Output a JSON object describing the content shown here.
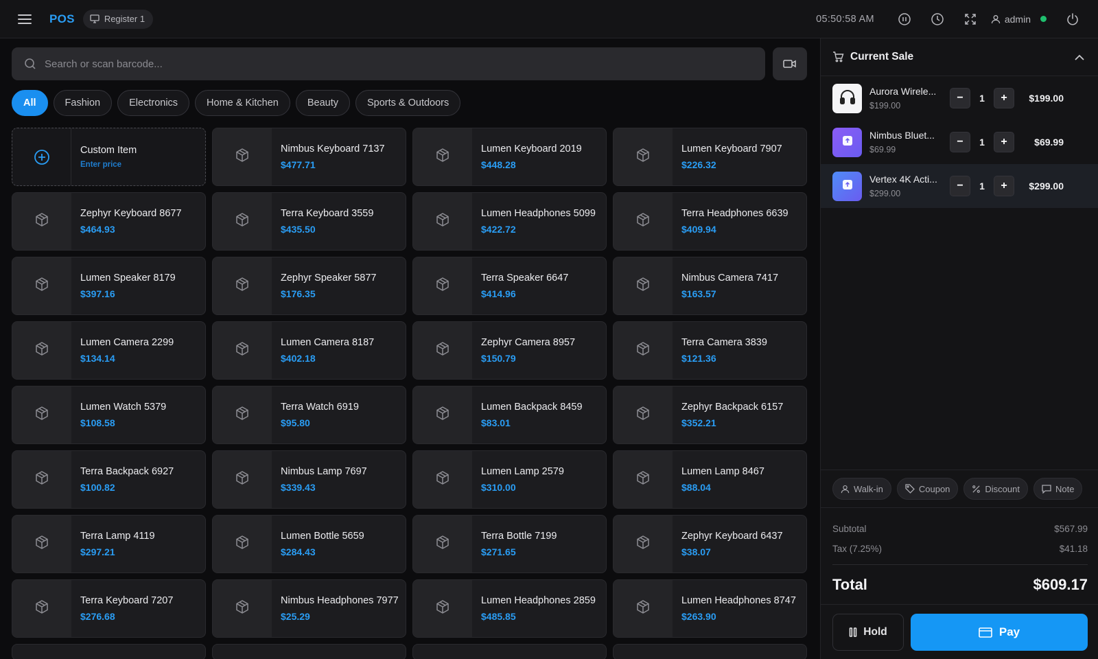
{
  "header": {
    "brand": "POS",
    "register": "Register 1",
    "clock": "05:50:58 AM",
    "user": "admin",
    "online_color": "#1fbf6e"
  },
  "search": {
    "placeholder": "Search or scan barcode..."
  },
  "categories": [
    "All",
    "Fashion",
    "Electronics",
    "Home & Kitchen",
    "Beauty",
    "Sports & Outdoors"
  ],
  "active_category": "All",
  "custom_item": {
    "name": "Custom Item",
    "subtitle": "Enter price"
  },
  "products": [
    {
      "name": "Nimbus Keyboard 7137",
      "price": "$477.71"
    },
    {
      "name": "Lumen Keyboard 2019",
      "price": "$448.28"
    },
    {
      "name": "Lumen Keyboard 7907",
      "price": "$226.32"
    },
    {
      "name": "Zephyr Keyboard 8677",
      "price": "$464.93"
    },
    {
      "name": "Terra Keyboard 3559",
      "price": "$435.50"
    },
    {
      "name": "Lumen Headphones 5099",
      "price": "$422.72"
    },
    {
      "name": "Terra Headphones 6639",
      "price": "$409.94"
    },
    {
      "name": "Lumen Speaker 8179",
      "price": "$397.16"
    },
    {
      "name": "Zephyr Speaker 5877",
      "price": "$176.35"
    },
    {
      "name": "Terra Speaker 6647",
      "price": "$414.96"
    },
    {
      "name": "Nimbus Camera 7417",
      "price": "$163.57"
    },
    {
      "name": "Lumen Camera 2299",
      "price": "$134.14"
    },
    {
      "name": "Lumen Camera 8187",
      "price": "$402.18"
    },
    {
      "name": "Zephyr Camera 8957",
      "price": "$150.79"
    },
    {
      "name": "Terra Camera 3839",
      "price": "$121.36"
    },
    {
      "name": "Lumen Watch 5379",
      "price": "$108.58"
    },
    {
      "name": "Terra Watch 6919",
      "price": "$95.80"
    },
    {
      "name": "Lumen Backpack 8459",
      "price": "$83.01"
    },
    {
      "name": "Zephyr Backpack 6157",
      "price": "$352.21"
    },
    {
      "name": "Terra Backpack 6927",
      "price": "$100.82"
    },
    {
      "name": "Nimbus Lamp 7697",
      "price": "$339.43"
    },
    {
      "name": "Lumen Lamp 2579",
      "price": "$310.00"
    },
    {
      "name": "Lumen Lamp 8467",
      "price": "$88.04"
    },
    {
      "name": "Terra Lamp 4119",
      "price": "$297.21"
    },
    {
      "name": "Lumen Bottle 5659",
      "price": "$284.43"
    },
    {
      "name": "Terra Bottle 7199",
      "price": "$271.65"
    },
    {
      "name": "Zephyr Keyboard 6437",
      "price": "$38.07"
    },
    {
      "name": "Terra Keyboard 7207",
      "price": "$276.68"
    },
    {
      "name": "Nimbus Headphones 7977",
      "price": "$25.29"
    },
    {
      "name": "Lumen Headphones 2859",
      "price": "$485.85"
    },
    {
      "name": "Lumen Headphones 8747",
      "price": "$263.90"
    }
  ],
  "sale": {
    "title": "Current Sale",
    "lines": [
      {
        "name": "Aurora Wirele...",
        "unit_price": "$199.00",
        "qty": "1",
        "total": "$199.00",
        "icon": "headphones-icon",
        "selected": false
      },
      {
        "name": "Nimbus Bluet...",
        "unit_price": "$69.99",
        "qty": "1",
        "total": "$69.99",
        "icon": "app-upload-icon",
        "selected": false
      },
      {
        "name": "Vertex 4K Acti...",
        "unit_price": "$299.00",
        "qty": "1",
        "total": "$299.00",
        "icon": "app-upload-icon",
        "selected": true
      }
    ],
    "actions": [
      "Walk-in",
      "Coupon",
      "Discount",
      "Note"
    ],
    "subtotal_label": "Subtotal",
    "subtotal": "$567.99",
    "tax_label": "Tax (7.25%)",
    "tax": "$41.18",
    "total_label": "Total",
    "total": "$609.17",
    "hold_label": "Hold",
    "pay_label": "Pay"
  },
  "colors": {
    "accent": "#1597f5",
    "price": "#2a9df4"
  }
}
